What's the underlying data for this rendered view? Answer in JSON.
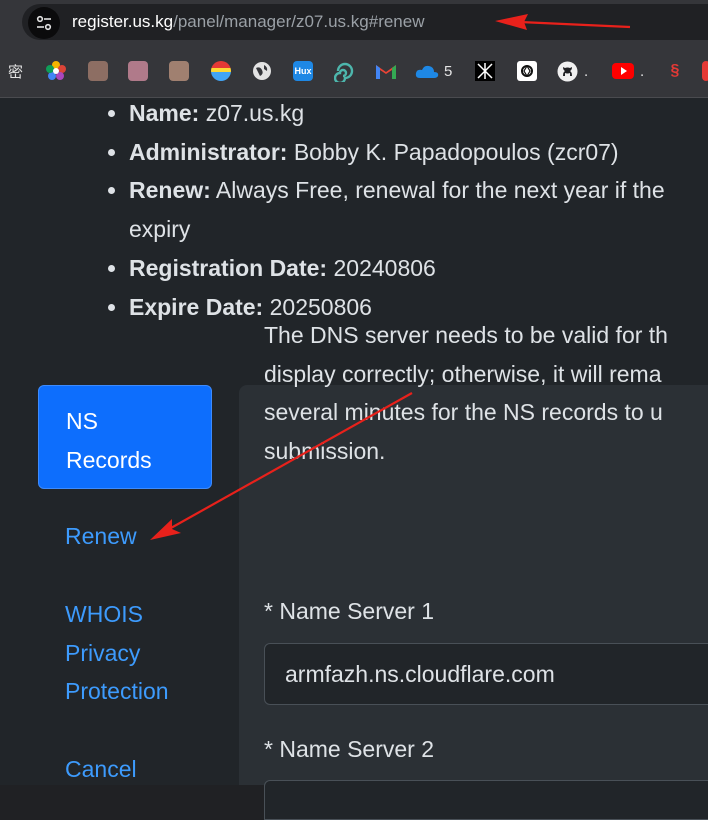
{
  "browser": {
    "url_host": "register.us.kg",
    "url_path": "/panel/manager/z07.us.kg#renew",
    "bookmarks": [
      {
        "icon": "text-icon",
        "label": "密"
      },
      {
        "icon": "flower-icon",
        "label": ""
      },
      {
        "icon": "avatar-icon",
        "label": ""
      },
      {
        "icon": "avatar-icon",
        "label": ""
      },
      {
        "icon": "avatar-icon",
        "label": ""
      },
      {
        "icon": "chrome-ball-icon",
        "label": ""
      },
      {
        "icon": "globe-icon",
        "label": ""
      },
      {
        "icon": "hux-icon",
        "label": "Hux"
      },
      {
        "icon": "spiral-icon",
        "label": ""
      },
      {
        "icon": "gmail-icon",
        "label": ""
      },
      {
        "icon": "onedrive-icon",
        "label": "5"
      },
      {
        "icon": "gear-logo-icon",
        "label": ""
      },
      {
        "icon": "openai-icon",
        "label": ""
      },
      {
        "icon": "github-icon",
        "label": "."
      },
      {
        "icon": "youtube-icon",
        "label": "."
      },
      {
        "icon": "red-logo-icon",
        "label": ""
      },
      {
        "icon": "red-square-icon",
        "label": ""
      }
    ]
  },
  "domain_info": {
    "items": [
      {
        "label": "Name:",
        "value": " z07.us.kg"
      },
      {
        "label": "Administrator:",
        "value": " Bobby K. Papadopoulos (zcr07)"
      },
      {
        "label": "Renew:",
        "value": " Always Free, renewal for the next year if the",
        "value2": "expiry"
      },
      {
        "label": "Registration Date:",
        "value": " 20240806"
      },
      {
        "label": "Expire Date:",
        "value": " 20250806"
      }
    ]
  },
  "nav": {
    "active_line1": "NS",
    "active_line2": "Records",
    "renew": "Renew",
    "whois_line1": "WHOIS",
    "whois_line2": "Privacy",
    "whois_line3": "Protection",
    "cancel": "Cancel"
  },
  "panel": {
    "desc_lines": [
      "The DNS server needs to be valid for th",
      "display correctly; otherwise, it will rema",
      "several minutes for the NS records to u",
      "submission."
    ],
    "ns1_label": "* Name Server 1",
    "ns1_value": "armfazh.ns.cloudflare.com",
    "ns2_label": "* Name Server 2"
  },
  "annotation_color": "#e8211b"
}
